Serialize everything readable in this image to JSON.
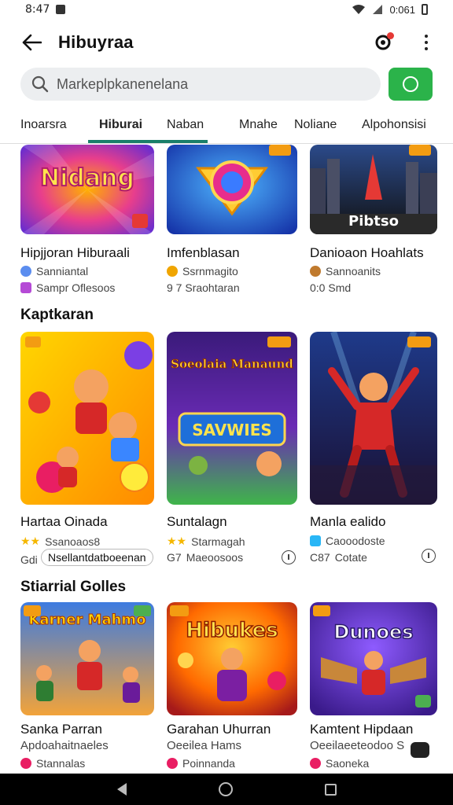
{
  "status_bar": {
    "time": "8:47",
    "right_text": "0:061"
  },
  "app": {
    "title": "Hibuyraa"
  },
  "search": {
    "placeholder": "Markeplpkanenelana"
  },
  "tabs": [
    {
      "label": "Inoarsra"
    },
    {
      "label": "Hiburai"
    },
    {
      "label": "Naban"
    },
    {
      "label": "Mnahe"
    },
    {
      "label": "Noliane"
    },
    {
      "label": "Alpohonsisi"
    }
  ],
  "row1": [
    {
      "title": "Hipjjoran Hiburaali",
      "meta1": "Sanniantal",
      "meta2": "Sampr Oflesoos",
      "thumb_text": "Nidang"
    },
    {
      "title": "Imfenblasan",
      "meta1": "Ssrnmagito",
      "meta2": "9 7  Sraohtaran",
      "thumb_text": ""
    },
    {
      "title": "Danioaon Hoahlats",
      "meta1": "Sannoanits",
      "meta2": "0:0  Smd",
      "thumb_text": "Pibtso"
    }
  ],
  "sections": {
    "second": "Kaptkaran",
    "third": "Stiarrial Golles"
  },
  "row2": [
    {
      "title": "Hartaa Oinada",
      "meta1": "Ssanoaos8",
      "meta2": "Nsellantdatboeenan",
      "meta2_prefix": "Gdi"
    },
    {
      "title": "Suntalagn",
      "meta1": "Starmagah",
      "meta2": "Maeoosoos",
      "meta2_prefix": "G7",
      "thumb_text": "SAVWIES",
      "thumb_text2": "Soeolaia Manaund"
    },
    {
      "title": "Manla ealido",
      "meta1": "Caooodoste",
      "meta2": "Cotate",
      "meta2_prefix": "C87"
    }
  ],
  "row3": [
    {
      "title": "Sanka Parran",
      "meta1": "Apdoahaitnaeles",
      "meta2": "Stannalas",
      "thumb_text": "Karner Mahmo"
    },
    {
      "title": "Garahan Uhurran",
      "meta1": "Oeeilea Hams",
      "meta2": "Poinnanda",
      "thumb_text": "Hibukes"
    },
    {
      "title": "Kamtent Hipdaan",
      "meta1": "Oeeilaeeteodoo S",
      "meta2": "Saoneka",
      "thumb_text": "Dunoes"
    }
  ],
  "colors": {
    "accent": "#1a7f6a",
    "go_button": "#2bb34a",
    "badge": "#f39c12",
    "notif_dot": "#e53935"
  }
}
